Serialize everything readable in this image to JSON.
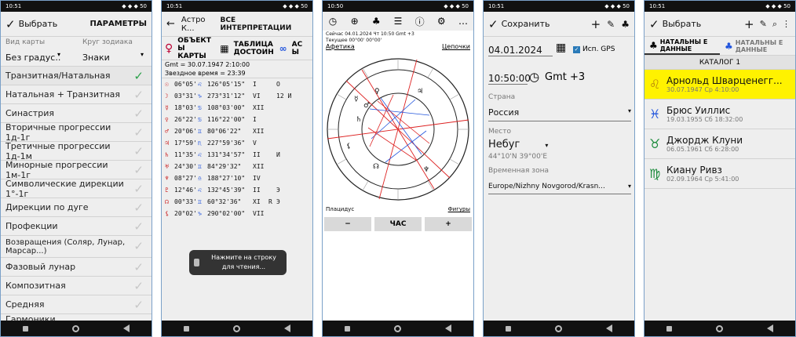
{
  "status": {
    "time1": "10:51",
    "time2": "10:51",
    "time3": "10:50",
    "time4": "10:51",
    "time5": "10:51",
    "icons": "◆ ◆ ◆ 50"
  },
  "nav": {
    "back": "◀"
  },
  "p1": {
    "select": "Выбрать",
    "params": "ПАРАМЕТРЫ",
    "map_type_label": "Вид карты",
    "zodiac_label": "Круг зодиака",
    "map_type_value": "Без градус..",
    "zodiac_value": "Знаки",
    "items": [
      "Транзитная/Натальная",
      "Натальная + Транзитная",
      "Синастрия",
      "Вторичные прогрессии 1д-1г",
      "Третичные прогрессии 1д-1м",
      "Минорные прогрессии 1м-1г",
      "Символические дирекции 1°-1г",
      "Дирекции по дуге",
      "Профекции",
      "Возвращения (Соляр, Лунар, Марсар...)",
      "Фазовый лунар",
      "Композитная",
      "Средняя",
      "Гармоники"
    ]
  },
  "p2": {
    "title": "Астро К...",
    "all": "ВСЕ ИНТЕРПРЕТАЦИИ",
    "tab1": "ОБЪЕКТ Ы КАРТЫ",
    "tab2": "ТАБЛИЦА ДОСТОИН",
    "tab3": "АС Ы",
    "gmt": "Gmt = 30.07.1947 2:10:00",
    "star": "Звездное время = 23:39",
    "rows": [
      {
        "sym": "☉",
        "deg": "06°05'",
        "sign": "♌",
        "lon": "126°05'15\"",
        "house": "I",
        "asp": "О",
        "r": ""
      },
      {
        "sym": "☽",
        "deg": "03°31'",
        "sign": "♑",
        "lon": "273°31'12\"",
        "house": "VI",
        "asp": "12 И",
        "r": ""
      },
      {
        "sym": "☿",
        "deg": "18°03'",
        "sign": "♋",
        "lon": "108°03'00\"",
        "house": "XII",
        "asp": "",
        "r": ""
      },
      {
        "sym": "♀",
        "deg": "26°22'",
        "sign": "♋",
        "lon": "116°22'00\"",
        "house": "I",
        "asp": "",
        "r": ""
      },
      {
        "sym": "♂",
        "deg": "20°06'",
        "sign": "♊",
        "lon": "80°06'22\"",
        "house": "XII",
        "asp": "",
        "r": ""
      },
      {
        "sym": "♃",
        "deg": "17°59'",
        "sign": "♏",
        "lon": "227°59'36\"",
        "house": "V",
        "asp": "",
        "r": ""
      },
      {
        "sym": "♄",
        "deg": "11°35'",
        "sign": "♌",
        "lon": "131°34'57\"",
        "house": "II",
        "asp": "И",
        "r": ""
      },
      {
        "sym": "♅",
        "deg": "24°30'",
        "sign": "♊",
        "lon": "84°29'32\"",
        "house": "XII",
        "asp": "",
        "r": ""
      },
      {
        "sym": "♆",
        "deg": "08°27'",
        "sign": "♎",
        "lon": "188°27'10\"",
        "house": "IV",
        "asp": "",
        "r": ""
      },
      {
        "sym": "♇",
        "deg": "12°46'",
        "sign": "♌",
        "lon": "132°45'39\"",
        "house": "II",
        "asp": "Э",
        "r": ""
      },
      {
        "sym": "☊",
        "deg": "00°33'",
        "sign": "♊",
        "lon": "60°32'36\"",
        "house": "XI",
        "asp": "Э",
        "r": "R"
      },
      {
        "sym": "⚸",
        "deg": "20°02'",
        "sign": "♑",
        "lon": "290°02'00\"",
        "house": "VII",
        "asp": "",
        "r": ""
      }
    ],
    "toast": "Нажмите на строку для чтения..."
  },
  "p3": {
    "now": "Сейчас 04.01.2024 Чт 10:50 Gmt +3",
    "cur": "Текущее 00°00' 00°00'",
    "afetika": "Афетика",
    "cusps": "Цепочки",
    "placidus": "Плацидус",
    "figures": "Фигуры",
    "minus": "−",
    "hour": "ЧАС",
    "plus": "+"
  },
  "p4": {
    "save": "Сохранить",
    "date": "04.01.2024",
    "gps": "Исп. GPS",
    "time": "10:50:00",
    "gmt": "Gmt +3",
    "country_label": "Страна",
    "country": "Россия",
    "place_label": "Место",
    "place": "Небуг",
    "coords": "44°10'N 39°00'E",
    "tz_label": "Временная зона",
    "tz": "Europe/Nizhny Novgorod/Krasn..."
  },
  "p5": {
    "select": "Выбрать",
    "tab1": "НАТАЛЬНЫ Е ДАННЫЕ",
    "tab2": "НАТАЛЬНЫ Е ДАННЫЕ",
    "catalog": "КАТАЛОГ 1",
    "rows": [
      {
        "sym": "♌",
        "name": "Арнольд Шварценегг...",
        "date": "30.07.1947 Ср 4:10:00"
      },
      {
        "sym": "♓",
        "name": "Брюс Уиллис",
        "date": "19.03.1955 Сб 18:32:00"
      },
      {
        "sym": "♉",
        "name": "Джордж Клуни",
        "date": "06.05.1961 Сб 6:28:00"
      },
      {
        "sym": "♍",
        "name": "Киану Ривз",
        "date": "02.09.1964 Ср 5:41:00"
      }
    ]
  },
  "colors": {
    "accent_green": "#2ba14a",
    "highlight": "#fff200",
    "red": "#d22",
    "blue": "#2255dd"
  }
}
